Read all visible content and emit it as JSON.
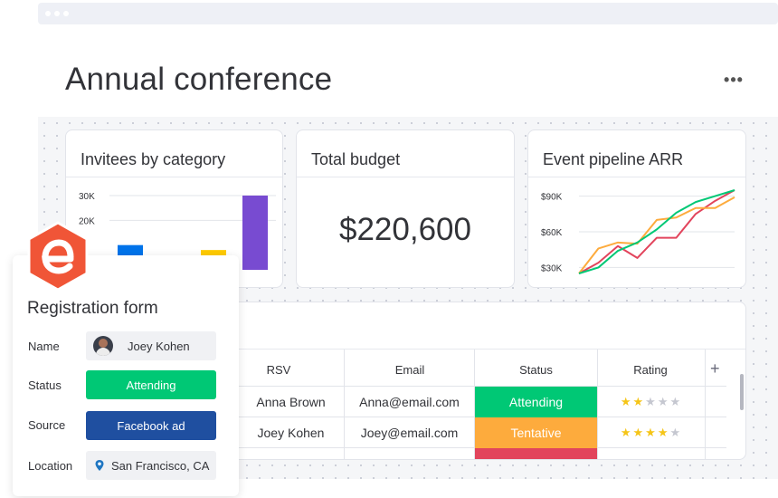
{
  "page": {
    "title": "Annual conference",
    "more_label": "•••"
  },
  "invitees_card": {
    "title": "Invitees by category"
  },
  "budget_card": {
    "title": "Total budget",
    "value": "$220,600"
  },
  "pipeline_card": {
    "title": "Event pipeline ARR"
  },
  "chart_data": [
    {
      "type": "bar",
      "title": "Invitees by category",
      "y_ticks": [
        "30K",
        "20K"
      ],
      "ylim": [
        0,
        30000
      ],
      "categories": [
        "",
        "",
        "",
        ""
      ],
      "values": [
        10000,
        500,
        8000,
        30000
      ],
      "colors": [
        "#0073ea",
        "#e2445c",
        "#ffcb00",
        "#784bd1"
      ]
    },
    {
      "type": "line",
      "title": "Event pipeline ARR",
      "y_ticks": [
        "$90K",
        "$60K",
        "$30K"
      ],
      "ylim": [
        25000,
        95000
      ],
      "x": [
        0,
        1,
        2,
        3,
        4,
        5,
        6,
        7,
        8
      ],
      "series": [
        {
          "color": "#e2445c",
          "values": [
            25000,
            34000,
            48000,
            38000,
            55000,
            55000,
            75000,
            86000,
            95000
          ]
        },
        {
          "color": "#fdab3d",
          "values": [
            25000,
            46000,
            51000,
            50000,
            70000,
            72000,
            80000,
            80000,
            89000
          ]
        },
        {
          "color": "#00c875",
          "values": [
            25000,
            30000,
            44000,
            51000,
            62000,
            76000,
            85000,
            90000,
            95000
          ]
        }
      ]
    }
  ],
  "table": {
    "headers": {
      "rsv": "RSV",
      "email": "Email",
      "status": "Status",
      "rating": "Rating",
      "add": "+"
    },
    "rows": [
      {
        "rsv": "Anna Brown",
        "email": "Anna@email.com",
        "status": "Attending",
        "status_color": "#00c875",
        "rating": 2
      },
      {
        "rsv": "Joey Kohen",
        "email": "Joey@email.com",
        "status": "Tentative",
        "status_color": "#fdab3d",
        "rating": 4
      },
      {
        "rsv": "",
        "email": "",
        "status": "",
        "status_color": "#e2445c",
        "rating": 0
      }
    ]
  },
  "form": {
    "title": "Registration form",
    "name_label": "Name",
    "name_value": "Joey Kohen",
    "status_label": "Status",
    "status_value": "Attending",
    "status_color": "#00c875",
    "source_label": "Source",
    "source_value": "Facebook ad",
    "source_color": "#1f4fa0",
    "location_label": "Location",
    "location_value": "San Francisco, CA"
  },
  "logo": {
    "icon": "eventbrite-e-logo",
    "color": "#f05537"
  },
  "icons": {
    "more": "more-dots-icon",
    "location": "location-pin-icon",
    "add": "plus-icon"
  }
}
